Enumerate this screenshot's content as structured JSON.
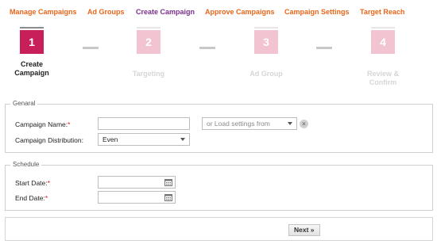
{
  "nav": {
    "items": [
      {
        "label": "Manage Campaigns",
        "active": false
      },
      {
        "label": "Ad Groups",
        "active": false
      },
      {
        "label": "Create Campaign",
        "active": true
      },
      {
        "label": "Approve Campaigns",
        "active": false
      },
      {
        "label": "Campaign Settings",
        "active": false
      },
      {
        "label": "Target Reach",
        "active": false
      }
    ]
  },
  "wizard": {
    "steps": [
      {
        "number": "1",
        "label": "Create Campaign",
        "state": "active"
      },
      {
        "number": "2",
        "label": "Targeting",
        "state": "inactive"
      },
      {
        "number": "3",
        "label": "Ad Group",
        "state": "inactive"
      },
      {
        "number": "4",
        "label": "Review & Confirm",
        "state": "inactive"
      }
    ]
  },
  "general": {
    "legend": "Genaral",
    "campaign_name_label": "Campaign Name:",
    "required_mark": "*",
    "campaign_name_value": "",
    "load_settings_placeholder": "or Load settings from",
    "distribution_label": "Campaign Distribution:",
    "distribution_value": "Even"
  },
  "schedule": {
    "legend": "Schedule",
    "start_date_label": "Start Date:",
    "end_date_label": "End Date:",
    "required_mark": "*",
    "start_date_value": "",
    "end_date_value": ""
  },
  "footer": {
    "next_label": "Next »"
  },
  "colors": {
    "nav_link": "#e8661a",
    "nav_active": "#7b2f8c",
    "step_active": "#c81e5a",
    "step_inactive": "#f2c3d1",
    "required": "#e0141e"
  },
  "icons": {
    "clear": "clear-icon",
    "calendar": "calendar-icon",
    "dropdown": "chevron-down-icon"
  }
}
